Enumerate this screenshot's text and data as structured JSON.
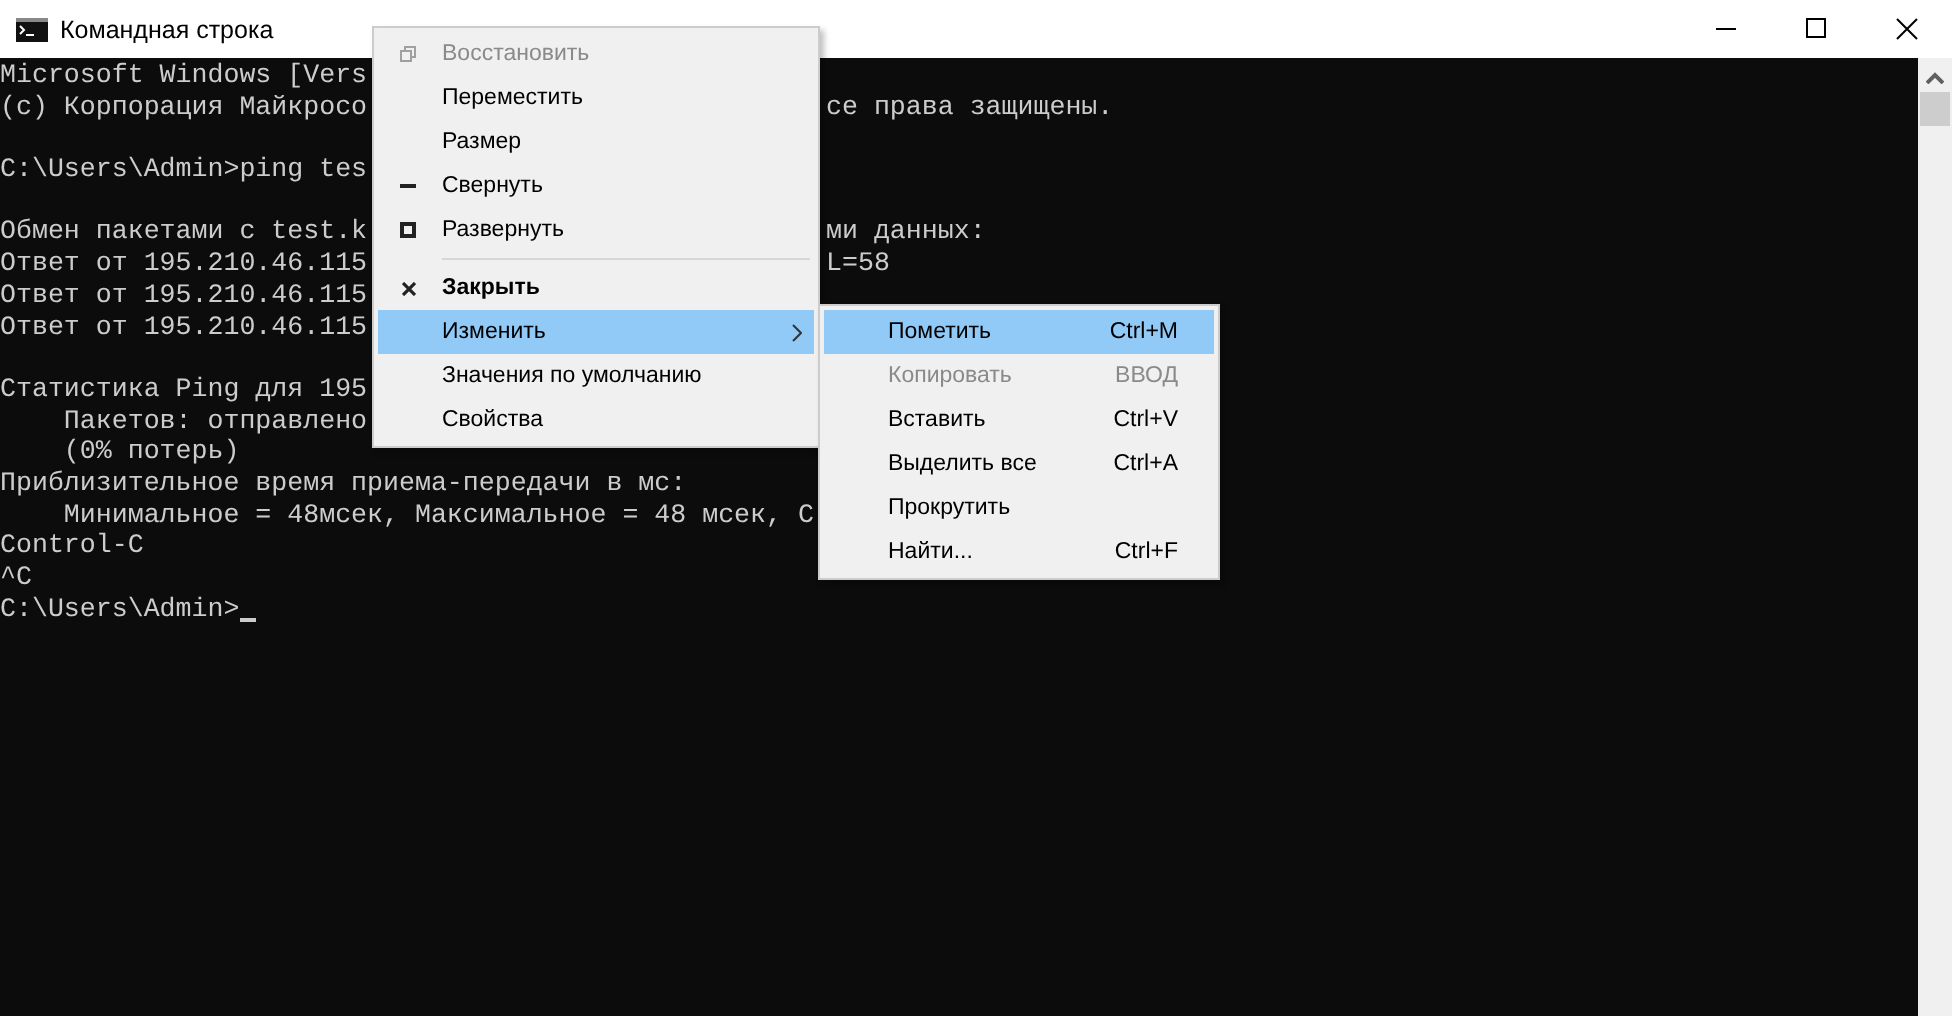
{
  "window": {
    "title": "Командная строка"
  },
  "terminal": {
    "blocks": [
      [
        {
          "left": "Microsoft Windows [Vers"
        },
        {
          "left": "(c) Корпорация Майкросо",
          "right": "се права защищены."
        }
      ],
      [
        {
          "left": "C:\\Users\\Admin>ping tes"
        }
      ],
      [
        {
          "left": "Обмен пакетами с test.k",
          "right": "ми данных:"
        },
        {
          "left": "Ответ от 195.210.46.115",
          "right": "L=58"
        },
        {
          "left": "Ответ от 195.210.46.115"
        },
        {
          "left": "Ответ от 195.210.46.115"
        }
      ],
      [
        {
          "left": "Статистика Ping для 195"
        },
        {
          "left": "    Пакетов: отправлено"
        },
        {
          "left": "    (0% потерь)"
        },
        {
          "left": "Приблизительное время приема-передачи в мс:"
        },
        {
          "left": "    Минимальное = 48мсек, Максимальное = 48 мсек, С"
        },
        {
          "left": "Control-C"
        },
        {
          "left": "^C"
        },
        {
          "left": "C:\\Users\\Admin>",
          "cursor": true
        }
      ]
    ]
  },
  "system_menu": {
    "items": [
      {
        "label": "Восстановить",
        "kind": "restore",
        "disabled": true,
        "selected": false
      },
      {
        "label": "Переместить",
        "kind": "plain",
        "disabled": false,
        "selected": false
      },
      {
        "label": "Размер",
        "kind": "plain",
        "disabled": false,
        "selected": false
      },
      {
        "label": "Свернуть",
        "kind": "minimize",
        "disabled": false,
        "selected": false
      },
      {
        "label": "Развернуть",
        "kind": "maximize",
        "disabled": false,
        "selected": false
      },
      {
        "kind": "separator"
      },
      {
        "label": "Закрыть",
        "kind": "close",
        "disabled": false,
        "selected": false
      },
      {
        "label": "Изменить",
        "kind": "submenu",
        "disabled": false,
        "selected": true
      },
      {
        "label": "Значения по умолчанию",
        "kind": "plain",
        "disabled": false,
        "selected": false
      },
      {
        "label": "Свойства",
        "kind": "plain",
        "disabled": false,
        "selected": false
      }
    ]
  },
  "edit_submenu": {
    "items": [
      {
        "label": "Пометить",
        "shortcut": "Ctrl+M",
        "disabled": false,
        "selected": true
      },
      {
        "label": "Копировать",
        "shortcut": "ВВОД",
        "disabled": true,
        "selected": false
      },
      {
        "label": "Вставить",
        "shortcut": "Ctrl+V",
        "disabled": false,
        "selected": false
      },
      {
        "label": "Выделить все",
        "shortcut": "Ctrl+A",
        "disabled": false,
        "selected": false
      },
      {
        "label": "Прокрутить",
        "disabled": false,
        "selected": false
      },
      {
        "label": "Найти...",
        "shortcut": "Ctrl+F",
        "disabled": false,
        "selected": false
      }
    ]
  }
}
